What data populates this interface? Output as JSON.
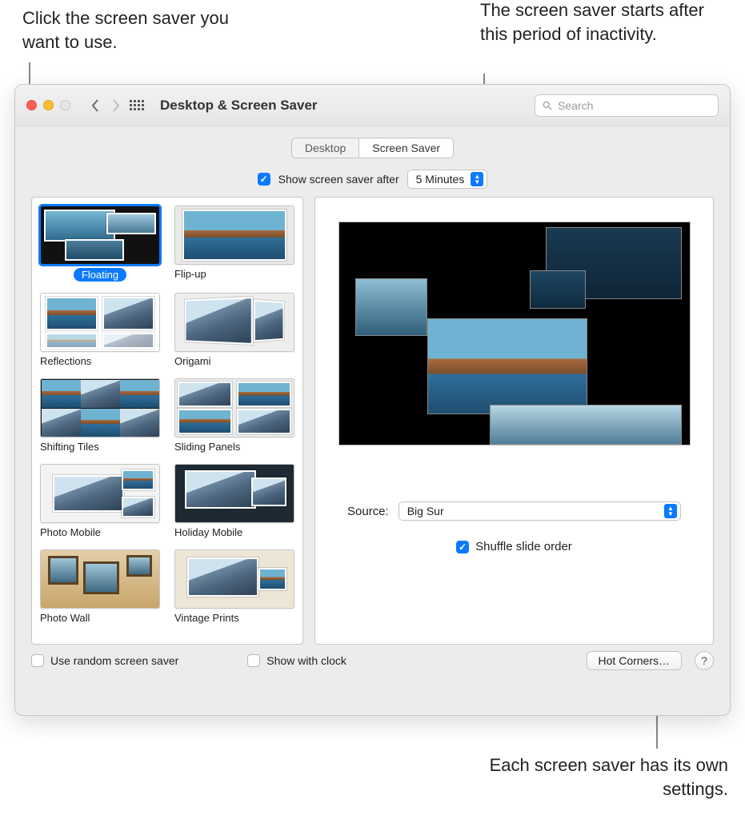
{
  "callouts": {
    "select": "Click the screen saver you want to use.",
    "inactivity": "The screen saver starts after this period of inactivity.",
    "settings": "Each screen saver has its own settings."
  },
  "window": {
    "title": "Desktop & Screen Saver",
    "search_placeholder": "Search"
  },
  "tabs": {
    "desktop": "Desktop",
    "screensaver": "Screen Saver"
  },
  "after": {
    "label": "Show screen saver after",
    "value": "5 Minutes"
  },
  "savers": [
    {
      "name": "Floating",
      "css": "floating",
      "selected": true
    },
    {
      "name": "Flip-up",
      "css": "flipup",
      "selected": false
    },
    {
      "name": "Reflections",
      "css": "reflections",
      "selected": false
    },
    {
      "name": "Origami",
      "css": "origami",
      "selected": false
    },
    {
      "name": "Shifting Tiles",
      "css": "shifting",
      "selected": false
    },
    {
      "name": "Sliding Panels",
      "css": "sliding",
      "selected": false
    },
    {
      "name": "Photo Mobile",
      "css": "photomobile",
      "selected": false
    },
    {
      "name": "Holiday Mobile",
      "css": "holiday",
      "selected": false
    },
    {
      "name": "Photo Wall",
      "css": "photowall",
      "selected": false
    },
    {
      "name": "Vintage Prints",
      "css": "vintage",
      "selected": false
    }
  ],
  "source": {
    "label": "Source:",
    "value": "Big Sur"
  },
  "shuffle_label": "Shuffle slide order",
  "footer": {
    "random": "Use random screen saver",
    "clock": "Show with clock",
    "hotcorners": "Hot Corners…"
  }
}
